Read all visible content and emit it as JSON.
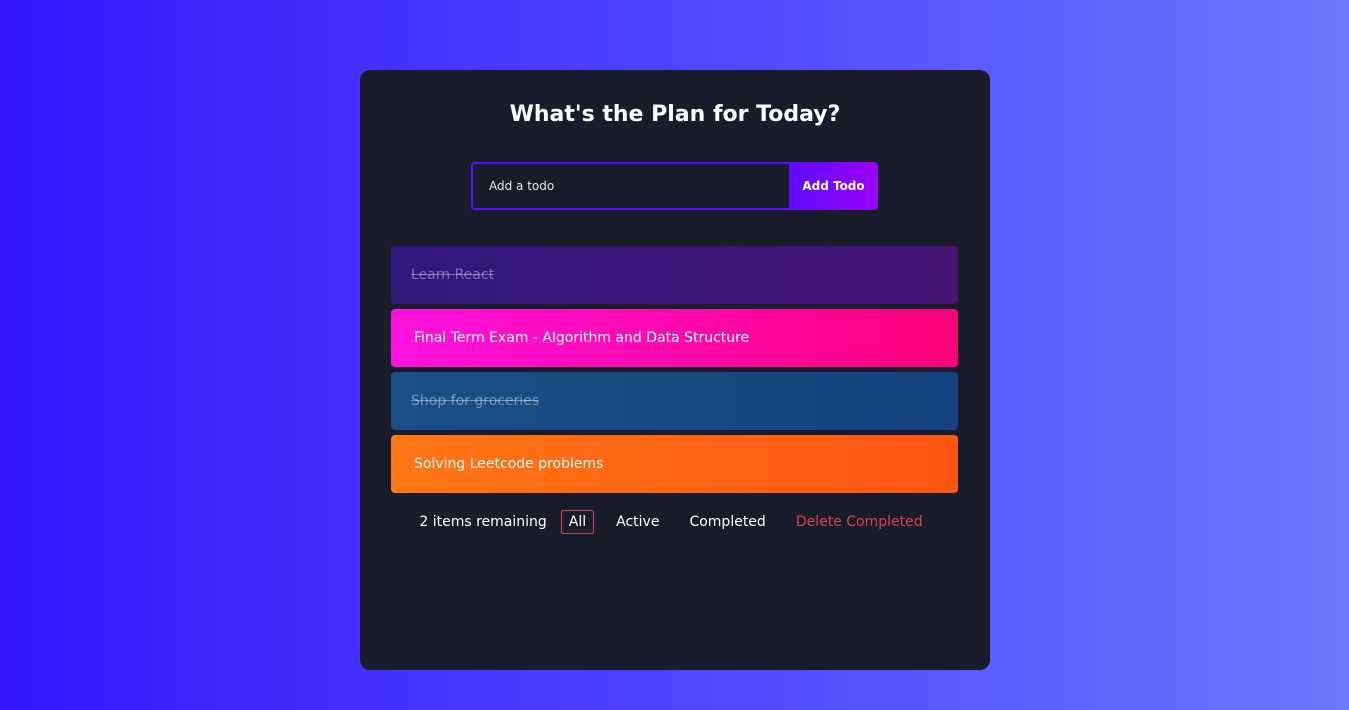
{
  "title": "What's the Plan for Today?",
  "form": {
    "placeholder": "Add a todo",
    "button": "Add Todo"
  },
  "todos": [
    {
      "text": "Learn React",
      "completed": true
    },
    {
      "text": "Final Term Exam - Algorithm and Data Structure",
      "completed": false
    },
    {
      "text": "Shop for groceries",
      "completed": true
    },
    {
      "text": "Solving Leetcode problems",
      "completed": false
    }
  ],
  "footer": {
    "remaining": "2 items remaining",
    "filters": [
      "All",
      "Active",
      "Completed"
    ],
    "active_filter": "All",
    "delete": "Delete Completed"
  }
}
